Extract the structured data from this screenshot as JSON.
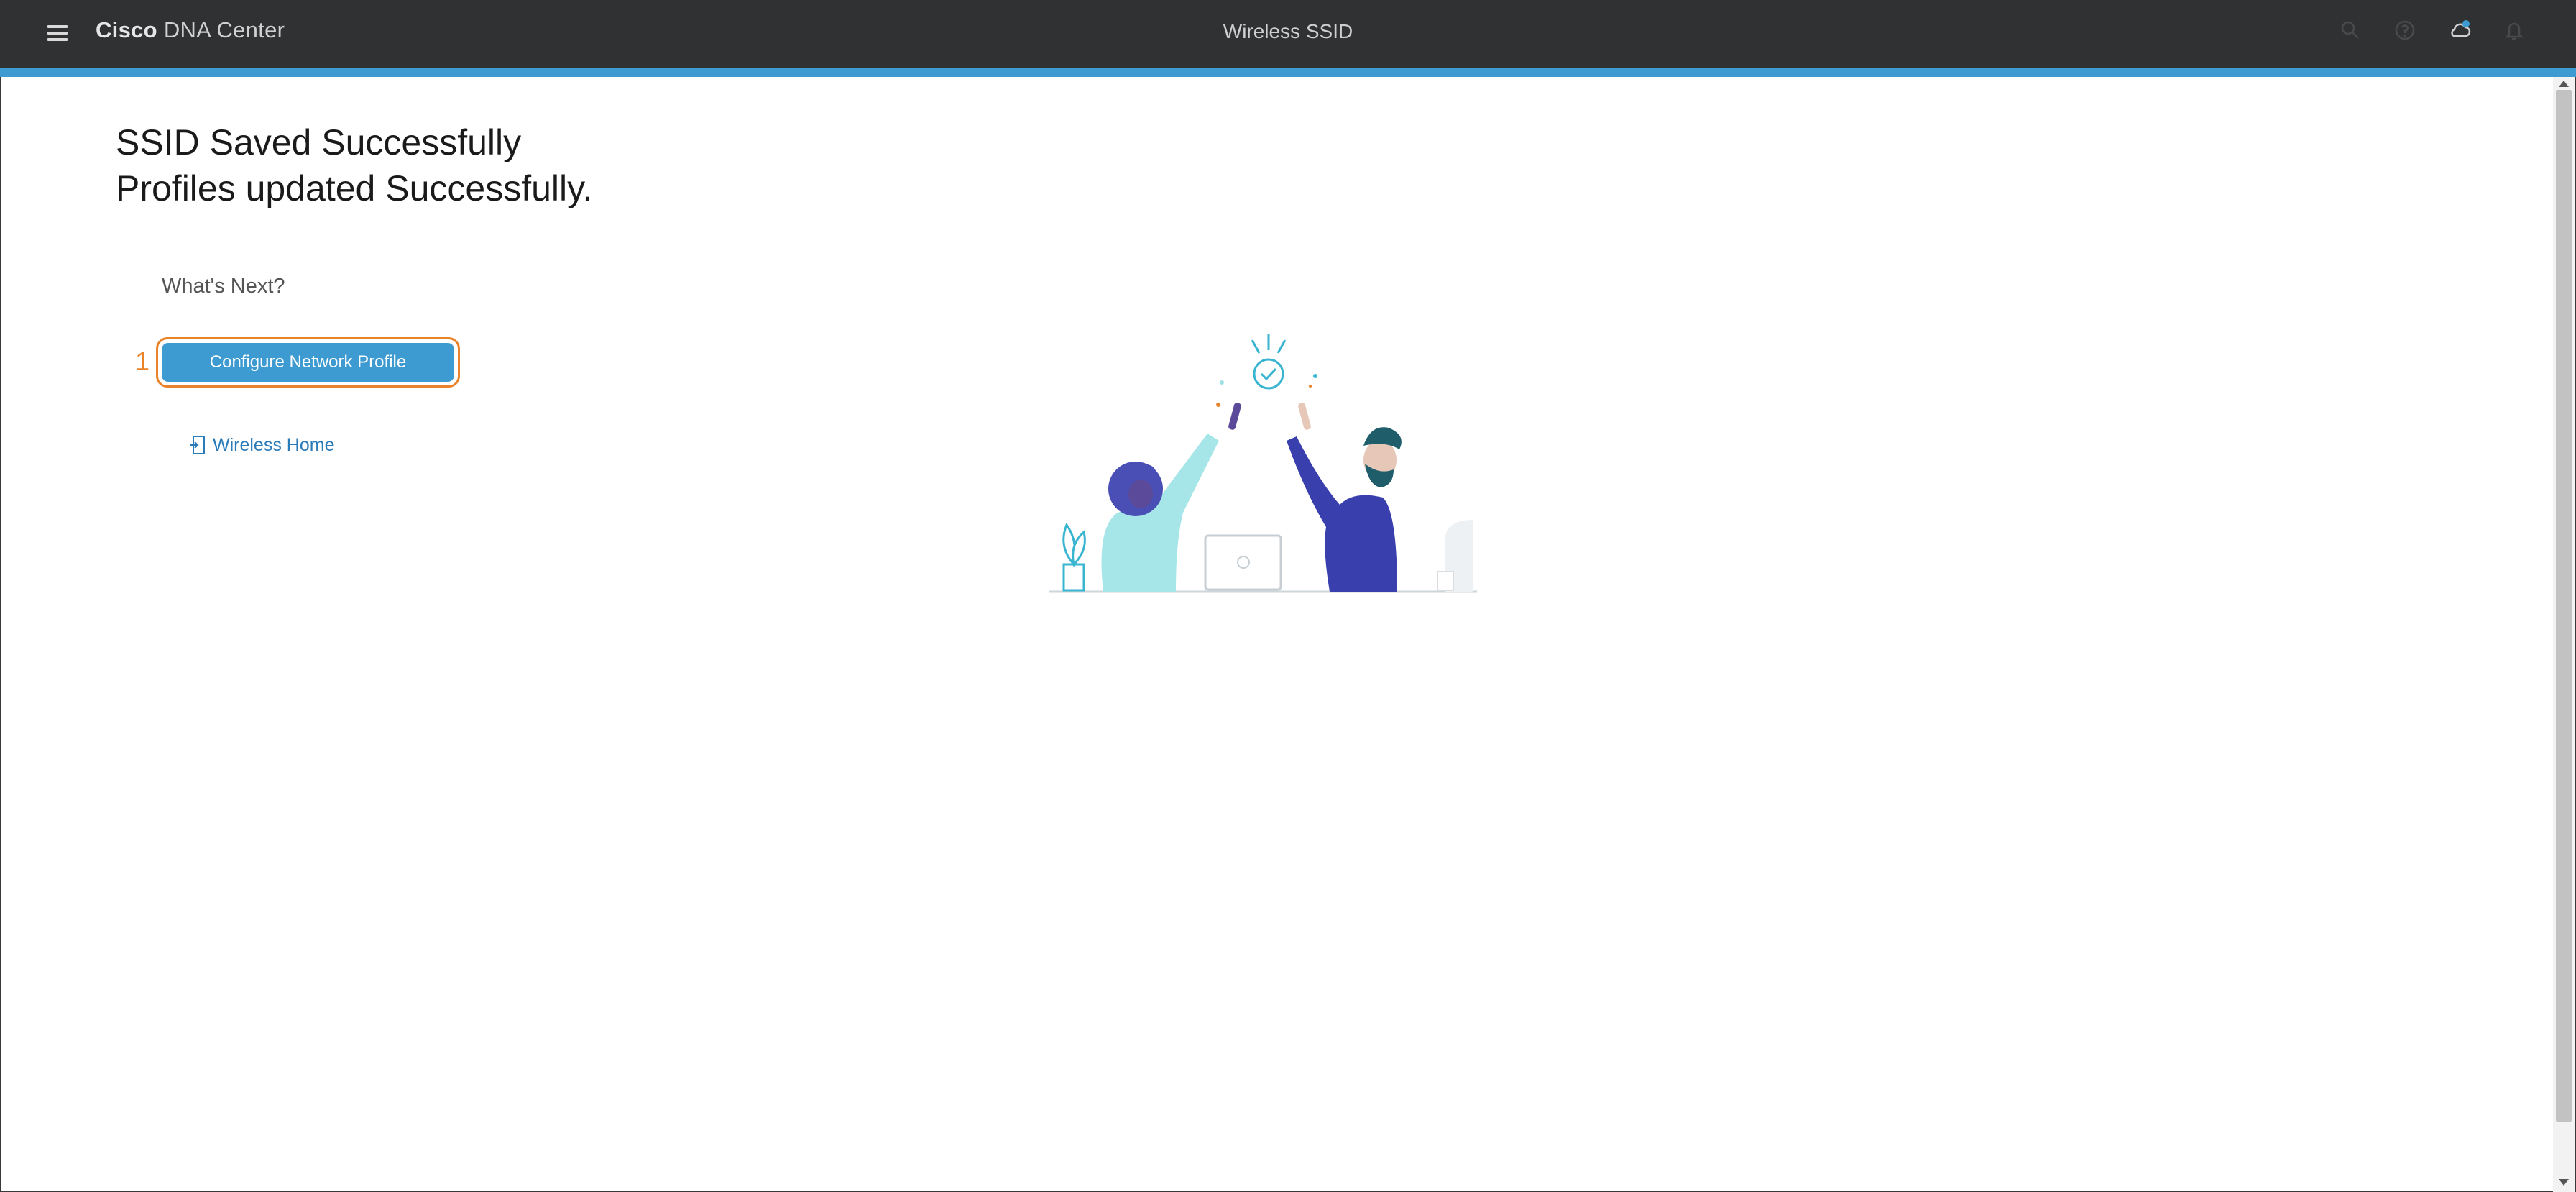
{
  "header": {
    "brand_bold": "Cisco",
    "brand_product": "DNA Center",
    "page_title": "Wireless SSID",
    "icons": [
      "search-icon",
      "help-icon",
      "cloud-notification-icon",
      "bell-icon"
    ]
  },
  "main": {
    "headline_line1": "SSID Saved Successfully",
    "headline_line2": "Profiles updated Successfully.",
    "whats_next": "What's Next?",
    "step_number": "1",
    "configure_button": "Configure Network Profile",
    "wireless_home_link": "Wireless Home"
  },
  "colors": {
    "topbar": "#2f3133",
    "accent": "#3d9bd1",
    "highlight": "#e8832a",
    "link": "#2b7bb9"
  }
}
